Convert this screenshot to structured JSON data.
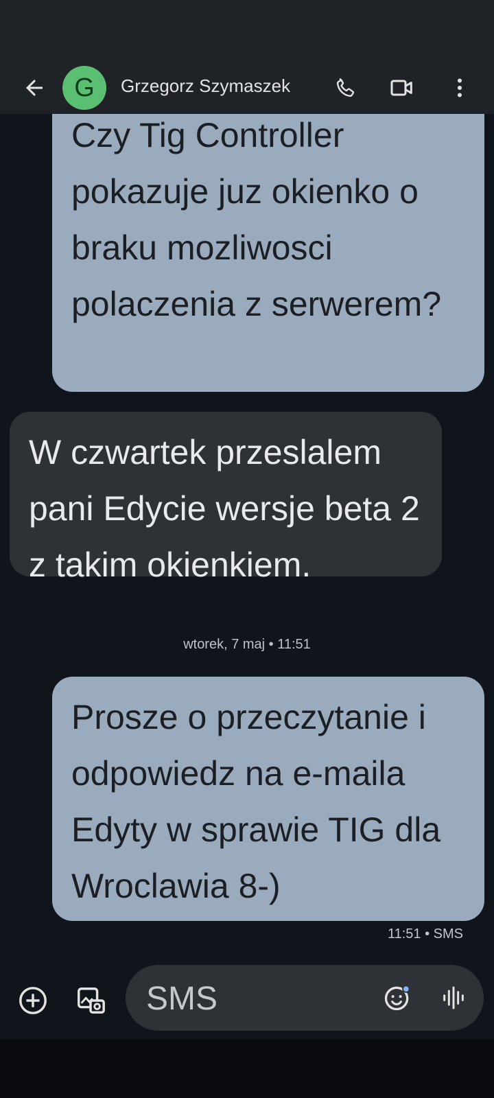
{
  "header": {
    "contact_name": "Grzegorz Szymaszek",
    "avatar_letter": "G",
    "back_icon": "arrow-back-icon",
    "call_icon": "phone-icon",
    "video_icon": "video-camera-icon",
    "more_icon": "more-vert-icon"
  },
  "messages": [
    {
      "direction": "outgoing",
      "text": "Czy Tig Controller pokazuje juz okienko o braku mozliwosci polaczenia z serwerem?"
    },
    {
      "direction": "incoming",
      "text": "W czwartek przeslalem pani Edycie wersje beta 2 z takim okienkiem."
    },
    {
      "direction": "outgoing",
      "text": "Prosze o przeczytanie i odpowiedz na e-maila Edyty w sprawie TIG dla Wroclawia 8-)"
    }
  ],
  "date_separator": "wtorek, 7 maj • 11:51",
  "last_message_meta": "11:51 • SMS",
  "compose": {
    "placeholder": "SMS",
    "add_icon": "add-circle-icon",
    "gallery_icon": "gallery-icon",
    "emoji_icon": "emoji-icon",
    "voice_icon": "voice-waveform-icon"
  },
  "colors": {
    "outgoing_bubble": "#9aabbd",
    "incoming_bubble": "#2e3136",
    "avatar": "#5bbf72",
    "background": "#10141b"
  }
}
